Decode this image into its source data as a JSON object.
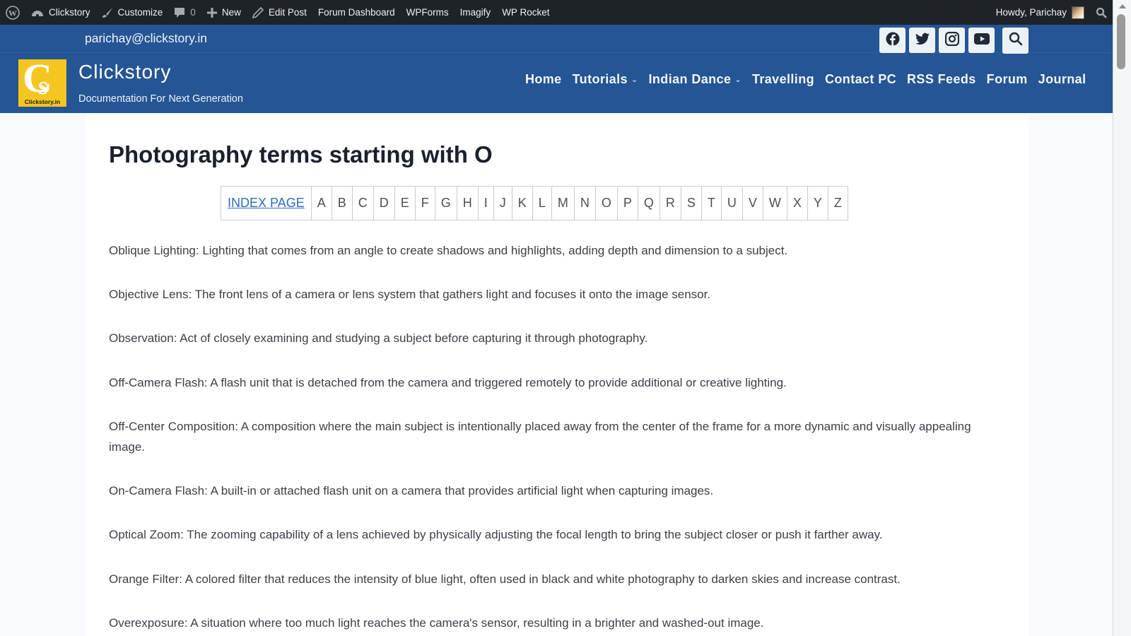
{
  "adminbar": {
    "items": [
      {
        "icon": "wordpress-logo-icon",
        "label": ""
      },
      {
        "icon": "dashboard-icon",
        "label": "Clickstory"
      },
      {
        "icon": "brush-icon",
        "label": "Customize"
      },
      {
        "icon": "comment-icon",
        "label": "0"
      },
      {
        "icon": "plus-icon",
        "label": "New"
      },
      {
        "icon": "pencil-icon",
        "label": "Edit Post"
      },
      {
        "icon": "",
        "label": "Forum Dashboard"
      },
      {
        "icon": "",
        "label": "WPForms"
      },
      {
        "icon": "",
        "label": "Imagify"
      },
      {
        "icon": "",
        "label": "WP Rocket"
      }
    ],
    "greeting": "Howdy, Parichay"
  },
  "header": {
    "email": "parichay@clickstory.in",
    "brand_name": "Clickstory",
    "tagline": "Documentation For Next Generation",
    "logo_letters": "C",
    "logo_sub": "s",
    "logo_label": "Clickstory.in",
    "socials": [
      "facebook",
      "twitter",
      "instagram",
      "youtube",
      "search"
    ],
    "nav": [
      {
        "label": "Home",
        "dropdown": false
      },
      {
        "label": "Tutorials",
        "dropdown": true
      },
      {
        "label": "Indian Dance",
        "dropdown": true
      },
      {
        "label": "Travelling",
        "dropdown": false
      },
      {
        "label": "Contact PC",
        "dropdown": false
      },
      {
        "label": "RSS Feeds",
        "dropdown": false
      },
      {
        "label": "Forum",
        "dropdown": false
      },
      {
        "label": "Journal",
        "dropdown": false
      }
    ]
  },
  "main": {
    "title": "Photography terms starting with O",
    "index_label": "INDEX PAGE",
    "letters": [
      "A",
      "B",
      "C",
      "D",
      "E",
      "F",
      "G",
      "H",
      "I",
      "J",
      "K",
      "L",
      "M",
      "N",
      "O",
      "P",
      "Q",
      "R",
      "S",
      "T",
      "U",
      "V",
      "W",
      "X",
      "Y",
      "Z"
    ],
    "terms": [
      "Oblique Lighting: Lighting that comes from an angle to create shadows and highlights, adding depth and dimension to a subject.",
      "Objective Lens: The front lens of a camera or lens system that gathers light and focuses it onto the image sensor.",
      "Observation: Act of closely examining and studying a subject before capturing it through photography.",
      "Off-Camera Flash: A flash unit that is detached from the camera and triggered remotely to provide additional or creative lighting.",
      "Off-Center Composition: A composition where the main subject is intentionally placed away from the center of the frame for a more dynamic and visually appealing image.",
      "On-Camera Flash: A built-in or attached flash unit on a camera that provides artificial light when capturing images.",
      "Optical Zoom: The zooming capability of a lens achieved by physically adjusting the focal length to bring the subject closer or push it farther away.",
      "Orange Filter: A colored filter that reduces the intensity of blue light, often used in black and white photography to darken skies and increase contrast.",
      "Overexposure: A situation where too much light reaches the camera's sensor, resulting in a brighter and washed-out image."
    ]
  },
  "colors": {
    "header_bg": "#255594",
    "adminbar_bg": "#1d2327",
    "logo_bg": "#f5c61f",
    "link": "#2f6bbd"
  }
}
